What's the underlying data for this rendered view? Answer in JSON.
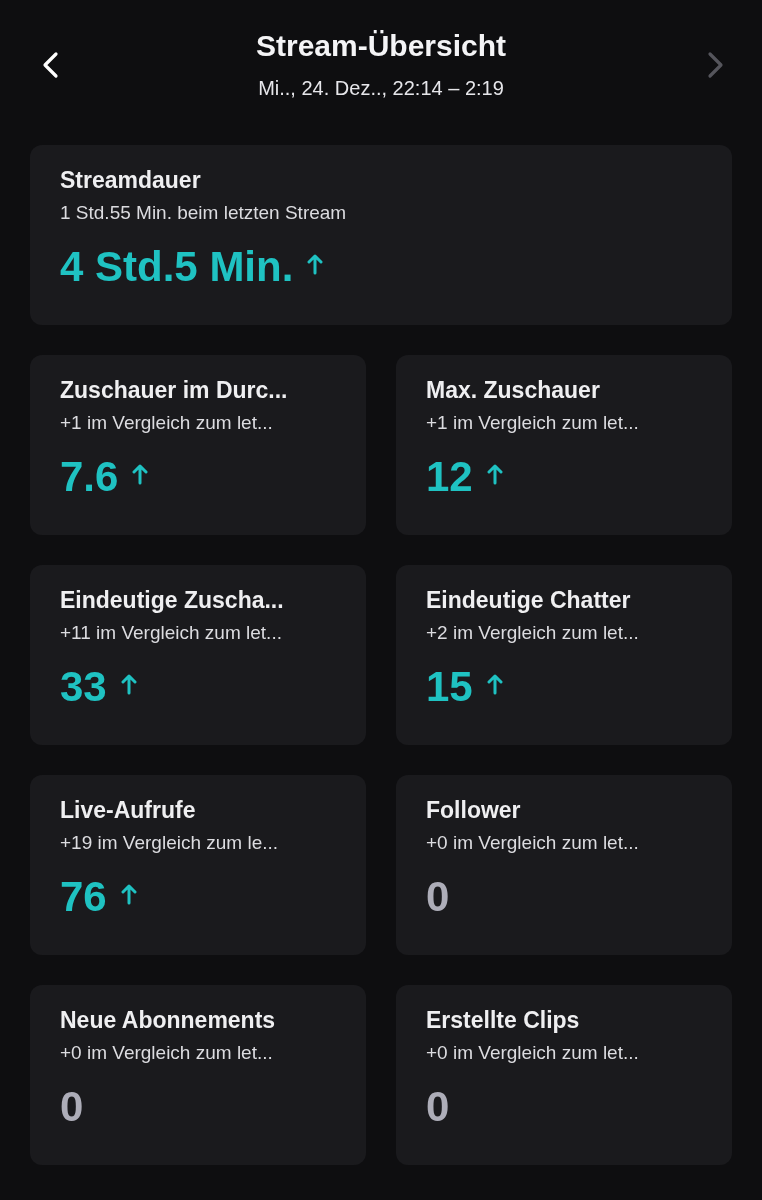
{
  "header": {
    "title": "Stream-Übersicht",
    "subtitle": "Mi.., 24. Dez.., 22:14 – 2:19",
    "next_disabled": true
  },
  "summary": {
    "title": "Streamdauer",
    "comparison": "1 Std.55 Min. beim letzten Stream",
    "value": "4 Std.5 Min.",
    "increased": true
  },
  "stats": [
    {
      "title": "Zuschauer im Durc...",
      "comparison": "+1 im Vergleich zum let...",
      "value": "7.6",
      "increased": true
    },
    {
      "title": "Max. Zuschauer",
      "comparison": "+1 im Vergleich zum let...",
      "value": "12",
      "increased": true
    },
    {
      "title": "Eindeutige Zuscha...",
      "comparison": "+11 im Vergleich zum let...",
      "value": "33",
      "increased": true
    },
    {
      "title": "Eindeutige Chatter",
      "comparison": "+2 im Vergleich zum let...",
      "value": "15",
      "increased": true
    },
    {
      "title": "Live-Aufrufe",
      "comparison": "+19 im Vergleich zum le...",
      "value": "76",
      "increased": true
    },
    {
      "title": "Follower",
      "comparison": "+0 im Vergleich zum let...",
      "value": "0",
      "increased": false
    },
    {
      "title": "Neue Abonnements",
      "comparison": "+0 im Vergleich zum let...",
      "value": "0",
      "increased": false
    },
    {
      "title": "Erstellte Clips",
      "comparison": "+0 im Vergleich zum let...",
      "value": "0",
      "increased": false
    }
  ]
}
